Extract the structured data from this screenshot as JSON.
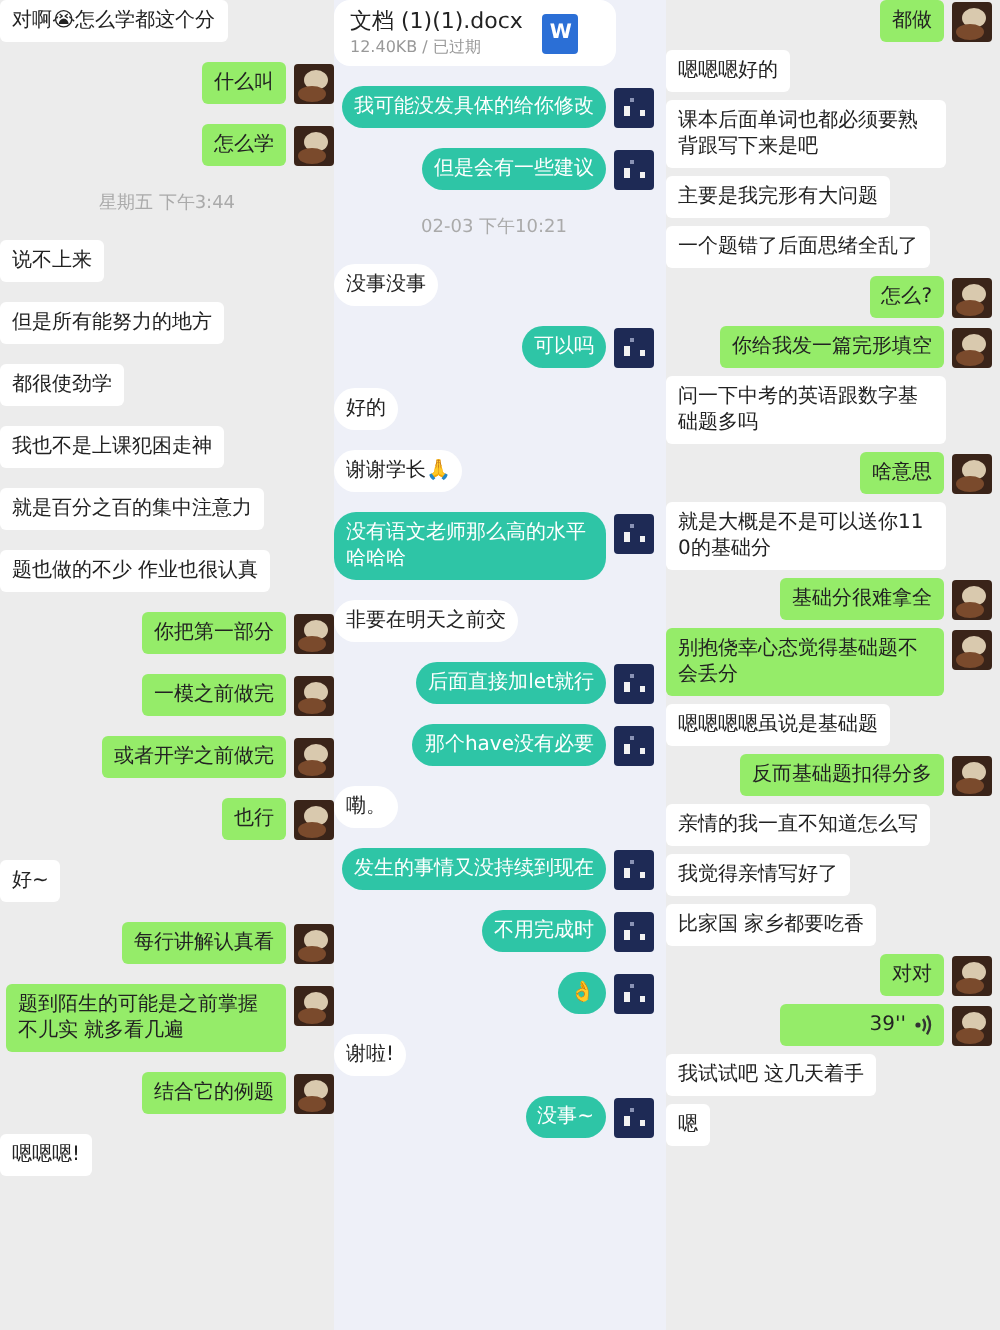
{
  "panels": [
    {
      "kind": "classic",
      "messages": [
        {
          "kind": "in",
          "text": "对啊😭怎么学都这个分"
        },
        {
          "kind": "out",
          "text": "什么叫"
        },
        {
          "kind": "out",
          "text": "怎么学"
        },
        {
          "kind": "time",
          "text": "星期五 下午3:44"
        },
        {
          "kind": "in",
          "text": "说不上来"
        },
        {
          "kind": "in",
          "text": "但是所有能努力的地方"
        },
        {
          "kind": "in",
          "text": "都很使劲学"
        },
        {
          "kind": "in",
          "text": "我也不是上课犯困走神"
        },
        {
          "kind": "in",
          "text": "就是百分之百的集中注意力"
        },
        {
          "kind": "in",
          "text": "题也做的不少 作业也很认真"
        },
        {
          "kind": "out",
          "text": "你把第一部分"
        },
        {
          "kind": "out",
          "text": "一模之前做完"
        },
        {
          "kind": "out",
          "text": "或者开学之前做完"
        },
        {
          "kind": "out",
          "text": "也行"
        },
        {
          "kind": "in",
          "text": "好~"
        },
        {
          "kind": "out",
          "text": "每行讲解认真看"
        },
        {
          "kind": "out",
          "text": "题到陌生的可能是之前掌握不儿实 就多看几遍"
        },
        {
          "kind": "out",
          "text": "结合它的例题"
        },
        {
          "kind": "in",
          "text": "嗯嗯嗯!"
        }
      ]
    },
    {
      "kind": "mint",
      "messages": [
        {
          "kind": "file",
          "text": "文档 (1)(1).docx",
          "detail": "12.40KB / 已过期",
          "icon_letter": "W"
        },
        {
          "kind": "out",
          "text": "我可能没发具体的给你修改"
        },
        {
          "kind": "out",
          "text": "但是会有一些建议"
        },
        {
          "kind": "time",
          "text": "02-03 下午10:21"
        },
        {
          "kind": "in",
          "text": "没事没事"
        },
        {
          "kind": "out",
          "text": "可以吗"
        },
        {
          "kind": "in",
          "text": "好的"
        },
        {
          "kind": "in",
          "text": "谢谢学长🙏"
        },
        {
          "kind": "out",
          "text": "没有语文老师那么高的水平哈哈哈"
        },
        {
          "kind": "in",
          "text": "非要在明天之前交"
        },
        {
          "kind": "out",
          "text": "后面直接加let就行"
        },
        {
          "kind": "out",
          "text": "那个have没有必要"
        },
        {
          "kind": "in",
          "text": "嘞。"
        },
        {
          "kind": "out",
          "text": "发生的事情又没持续到现在"
        },
        {
          "kind": "out",
          "text": "不用完成时"
        },
        {
          "kind": "out",
          "text": "👌"
        },
        {
          "kind": "in",
          "text": "谢啦!"
        },
        {
          "kind": "out",
          "text": "没事~"
        }
      ]
    },
    {
      "kind": "classic",
      "messages": [
        {
          "kind": "out",
          "text": "都做"
        },
        {
          "kind": "in",
          "text": "嗯嗯嗯好的"
        },
        {
          "kind": "in",
          "text": "课本后面单词也都必须要熟背跟写下来是吧"
        },
        {
          "kind": "in",
          "text": "主要是我完形有大问题"
        },
        {
          "kind": "in",
          "text": "一个题错了后面思绪全乱了"
        },
        {
          "kind": "out",
          "text": "怎么?"
        },
        {
          "kind": "out",
          "text": "你给我发一篇完形填空"
        },
        {
          "kind": "in",
          "text": "问一下中考的英语跟数字基础题多吗"
        },
        {
          "kind": "out",
          "text": "啥意思"
        },
        {
          "kind": "in",
          "text": "就是大概是不是可以送你110的基础分"
        },
        {
          "kind": "out",
          "text": "基础分很难拿全"
        },
        {
          "kind": "out",
          "text": "别抱侥幸心态觉得基础题不会丢分"
        },
        {
          "kind": "in",
          "text": "嗯嗯嗯嗯虽说是基础题"
        },
        {
          "kind": "out",
          "text": "反而基础题扣得分多"
        },
        {
          "kind": "in",
          "text": "亲情的我一直不知道怎么写"
        },
        {
          "kind": "in",
          "text": "我觉得亲情写好了"
        },
        {
          "kind": "in",
          "text": "比家国 家乡都要吃香"
        },
        {
          "kind": "out",
          "text": "对对"
        },
        {
          "kind": "voice",
          "text": "39''"
        },
        {
          "kind": "in",
          "text": "我试试吧 这几天着手"
        },
        {
          "kind": "in",
          "text": "嗯"
        }
      ]
    }
  ]
}
